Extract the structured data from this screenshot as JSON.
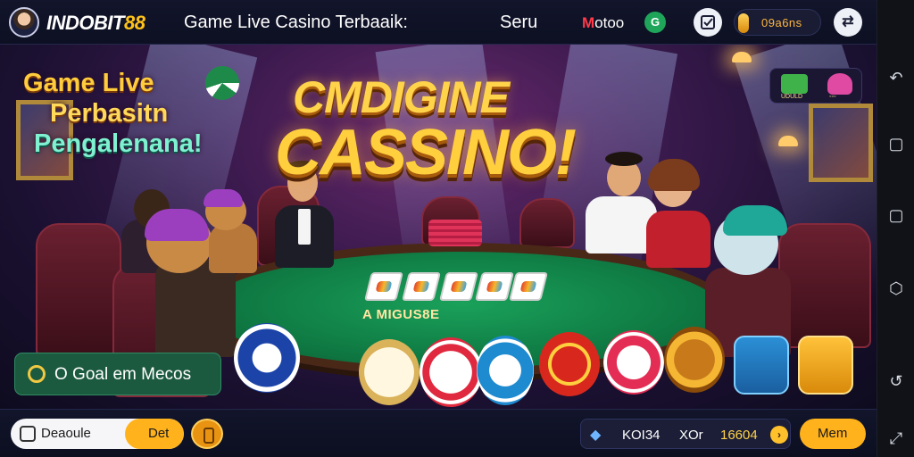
{
  "header": {
    "brand_main": "INDOBIT",
    "brand_num": "88",
    "headline": "Game Live Casino Terbaaik:",
    "seru": "Seru",
    "promo_m": "M",
    "promo_rest": "otoo",
    "g_badge": "G",
    "coin_value": "09a6ns",
    "share_glyph": "⇄",
    "icons": [
      "avatar",
      "g-badge-icon",
      "edit-icon",
      "coin-icon",
      "share-icon"
    ]
  },
  "scene": {
    "banner_line1": "CMDIGINE",
    "banner_line2": "CASSINO!",
    "side_line1": "Game Live",
    "side_line2": "Perbasitn",
    "side_line3": "Pengalenana!",
    "promo_tile_left": "UDULD",
    "promo_tile_right": "◦◦◦",
    "table_text": "A MIGUS8E",
    "goal_button": "O Goal em Mecos"
  },
  "footer": {
    "left_label": "Deaoule",
    "right_label": "Det",
    "stat_a": "KOI34",
    "stat_b": "XOr",
    "stat_c": "16604",
    "mem_label": "Mem",
    "arrow_glyph": "›"
  },
  "system": {
    "glyphs": [
      "↶",
      "▢",
      "▢",
      "⬡",
      "↺",
      "⤢"
    ]
  },
  "colors": {
    "gold": "#ffcf3d",
    "table_green": "#0f7a43",
    "orange_button": "#ffb21c",
    "dark_bar": "#12152b"
  }
}
